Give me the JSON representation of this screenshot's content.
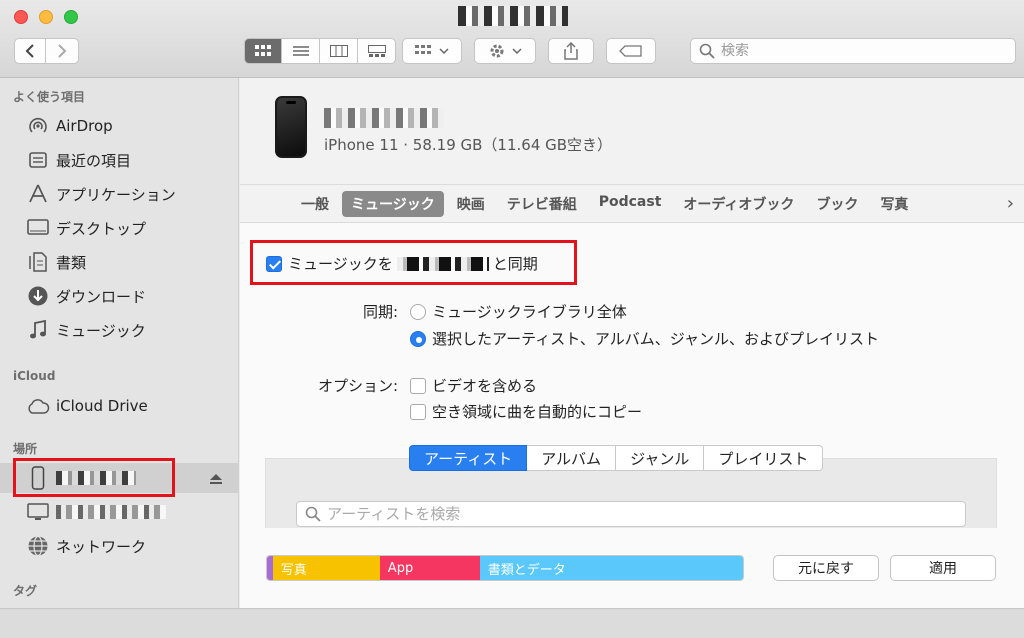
{
  "toolbar": {
    "search_placeholder": "検索"
  },
  "sidebar": {
    "favorites_title": "よく使う項目",
    "favorites": [
      {
        "label": "AirDrop",
        "icon": "airdrop-icon"
      },
      {
        "label": "最近の項目",
        "icon": "recents-icon"
      },
      {
        "label": "アプリケーション",
        "icon": "applications-icon"
      },
      {
        "label": "デスクトップ",
        "icon": "desktop-icon"
      },
      {
        "label": "書類",
        "icon": "documents-icon"
      },
      {
        "label": "ダウンロード",
        "icon": "downloads-icon"
      },
      {
        "label": "ミュージック",
        "icon": "music-icon"
      }
    ],
    "icloud_title": "iCloud",
    "icloud": [
      {
        "label": "iCloud Drive",
        "icon": "cloud-icon"
      }
    ],
    "locations_title": "場所",
    "locations": [
      {
        "label": "",
        "icon": "iphone-icon",
        "selected": true
      },
      {
        "label": "",
        "icon": "computer-icon"
      },
      {
        "label": "ネットワーク",
        "icon": "network-icon"
      }
    ],
    "tags_title": "タグ"
  },
  "device": {
    "subtitle": "iPhone 11 · 58.19 GB（11.64 GB空き）"
  },
  "tabs": [
    {
      "label": "一般"
    },
    {
      "label": "ミュージック",
      "active": true
    },
    {
      "label": "映画"
    },
    {
      "label": "テレビ番組"
    },
    {
      "label": "Podcast"
    },
    {
      "label": "オーディオブック"
    },
    {
      "label": "ブック"
    },
    {
      "label": "写真"
    }
  ],
  "music": {
    "sync_prefix": "ミュージックを",
    "sync_suffix": "と同期",
    "sync_checked": true,
    "sync_label": "同期:",
    "sync_options": [
      "ミュージックライブラリ全体",
      "選択したアーティスト、アルバム、ジャンル、およびプレイリスト"
    ],
    "sync_selected": 1,
    "options_label": "オプション:",
    "options": [
      "ビデオを含める",
      "空き領域に曲を自動的にコピー"
    ],
    "segments": [
      "アーティスト",
      "アルバム",
      "ジャンル",
      "プレイリスト"
    ],
    "filter_placeholder": "アーティストを検索"
  },
  "storage": [
    {
      "label": "",
      "color": "#a56bd6",
      "fraction": 0.012
    },
    {
      "label": "写真",
      "color": "#f7c200",
      "fraction": 0.225
    },
    {
      "label": "App",
      "color": "#f53660",
      "fraction": 0.21
    },
    {
      "label": "書類とデータ",
      "color": "#5ac8fa",
      "fraction": 0.553
    }
  ],
  "buttons": {
    "revert": "元に戻す",
    "apply": "適用"
  }
}
